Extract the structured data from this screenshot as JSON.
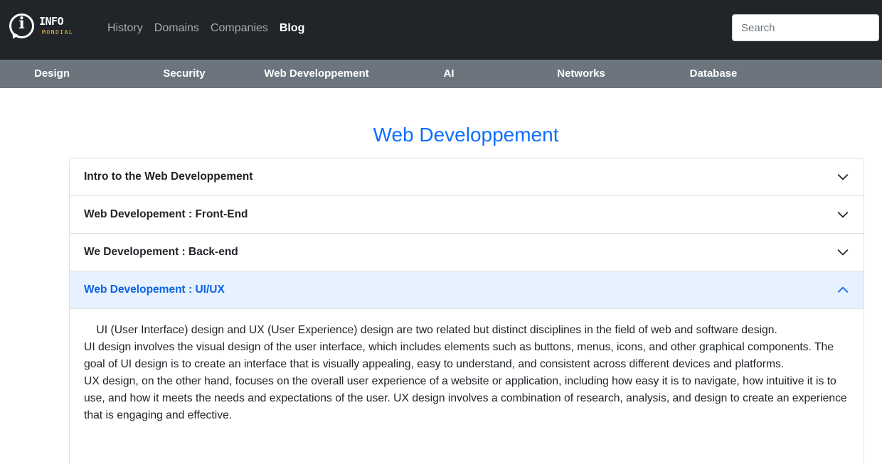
{
  "brand": {
    "name": "INFO",
    "sub": "MONDIAL"
  },
  "nav": [
    {
      "label": "History",
      "active": false
    },
    {
      "label": "Domains",
      "active": false
    },
    {
      "label": "Companies",
      "active": false
    },
    {
      "label": "Blog",
      "active": true
    }
  ],
  "search": {
    "placeholder": "Search",
    "value": ""
  },
  "categories": [
    "Design",
    "Security",
    "Web Developpement",
    "AI",
    "Networks",
    "Database"
  ],
  "page": {
    "title": "Web Developpement"
  },
  "accordion": {
    "items": [
      {
        "label": "Intro to the Web Developpement",
        "open": false
      },
      {
        "label": "Web Developement : Front-End",
        "open": false
      },
      {
        "label": "We Developement : Back-end",
        "open": false
      },
      {
        "label": "Web Developement : UI/UX",
        "open": true
      }
    ],
    "body": [
      "    UI (User Interface) design and UX (User Experience) design are two related but distinct disciplines in the field of web and software design.",
      "UI design involves the visual design of the user interface, which includes elements such as buttons, menus, icons, and other graphical components. The goal of UI design is to create an interface that is visually appealing, easy to understand, and consistent across different devices and platforms.",
      "UX design, on the other hand, focuses on the overall user experience of a website or application, including how easy it is to navigate, how intuitive it is to use, and how it meets the needs and expectations of the user. UX design involves a combination of research, analysis, and design to create an experience that is engaging and effective."
    ]
  },
  "colors": {
    "topbar": "#212529",
    "catbar": "#6c757d",
    "accent": "#0d6efd",
    "open_bg": "#e7f1ff"
  }
}
